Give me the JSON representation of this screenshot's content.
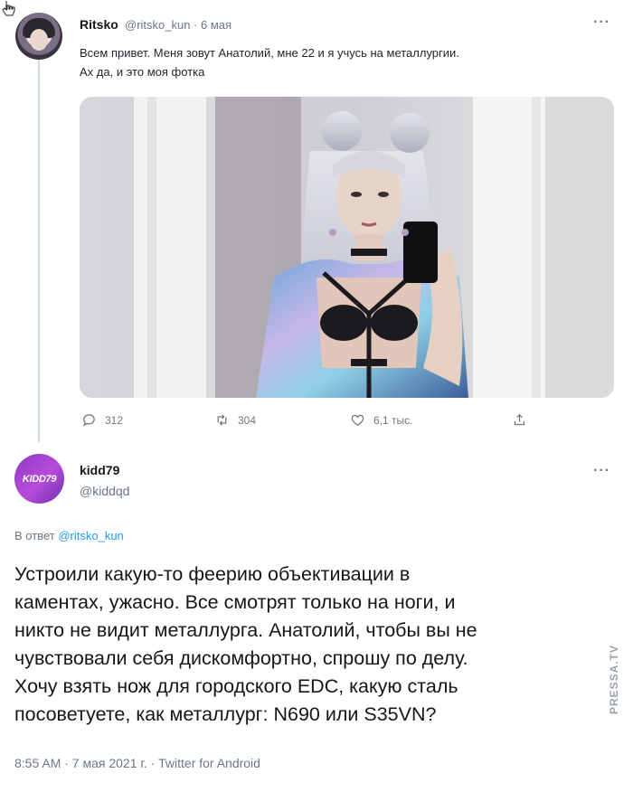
{
  "tweet1": {
    "author_name": "Ritsko",
    "handle_date": "@ritsko_kun · 6 мая",
    "more": "···",
    "text_line1": "Всем привет. Меня зовут Анатолий, мне 22 и я учусь на металлургии.",
    "text_line2": "Ах да, и это моя фотка",
    "actions": {
      "replies": "312",
      "retweets": "304",
      "likes": "6,1 тыс."
    }
  },
  "tweet2": {
    "author_name": "kidd79",
    "handle": "@kiddqd",
    "avatar_text": "KIDD79",
    "more": "···",
    "reply_prefix": "В ответ",
    "reply_handle": "@ritsko_kun",
    "text_lines": [
      "Устроили какую-то феерию объективации в",
      "каментах, ужасно. Все смотрят только на ноги, и",
      "никто не видит металлурга. Анатолий, чтобы вы не",
      "чувствовали себя дискомфортно, спрошу по делу.",
      "Хочу взять нож для городского EDC, какую сталь",
      "посоветуете, как металлург: N690 или S35VN?"
    ],
    "footer": "8:55 AM · 7 мая 2021 г. · Twitter for Android"
  },
  "watermark": "PRESSA.TV",
  "colors": {
    "link": "#1d9bf0",
    "secondary_text": "#6b7783",
    "thread_line": "#cfd9de"
  },
  "icons": [
    "reply-icon",
    "retweet-icon",
    "like-icon",
    "share-icon",
    "cursor-icon"
  ]
}
